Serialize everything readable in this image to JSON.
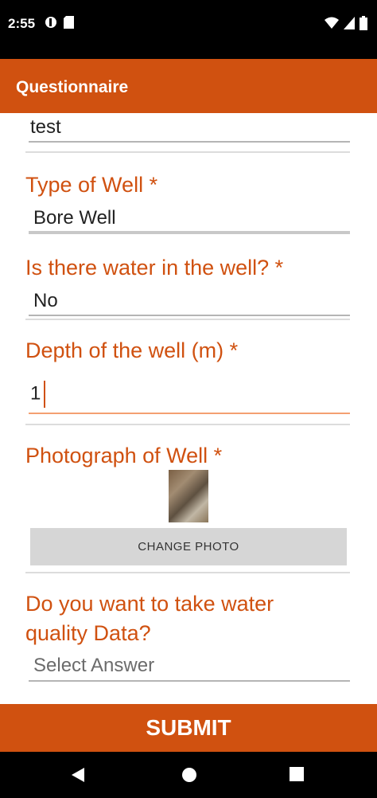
{
  "status_bar": {
    "time": "2:55",
    "icons": [
      "circle-status-icon",
      "sim-card-icon",
      "wifi-icon",
      "signal-icon",
      "battery-icon"
    ]
  },
  "app_bar": {
    "title": "Questionnaire",
    "color": "#d05110"
  },
  "form": {
    "previous_answer": "test",
    "questions": [
      {
        "label": "Type of Well *",
        "answer": "Bore Well"
      },
      {
        "label": "Is there water in the well? *",
        "answer": "No"
      },
      {
        "label": "Depth of the well (m) *",
        "answer": "1"
      },
      {
        "label": "Photograph of Well *",
        "button": "CHANGE PHOTO"
      },
      {
        "label_line1": "Do you want to take water",
        "label_line2": "quality Data?",
        "placeholder": "Select Answer"
      }
    ]
  },
  "submit_label": "SUBMIT",
  "nav_bar": {
    "icons": [
      "back-icon",
      "home-icon",
      "recents-icon"
    ]
  }
}
